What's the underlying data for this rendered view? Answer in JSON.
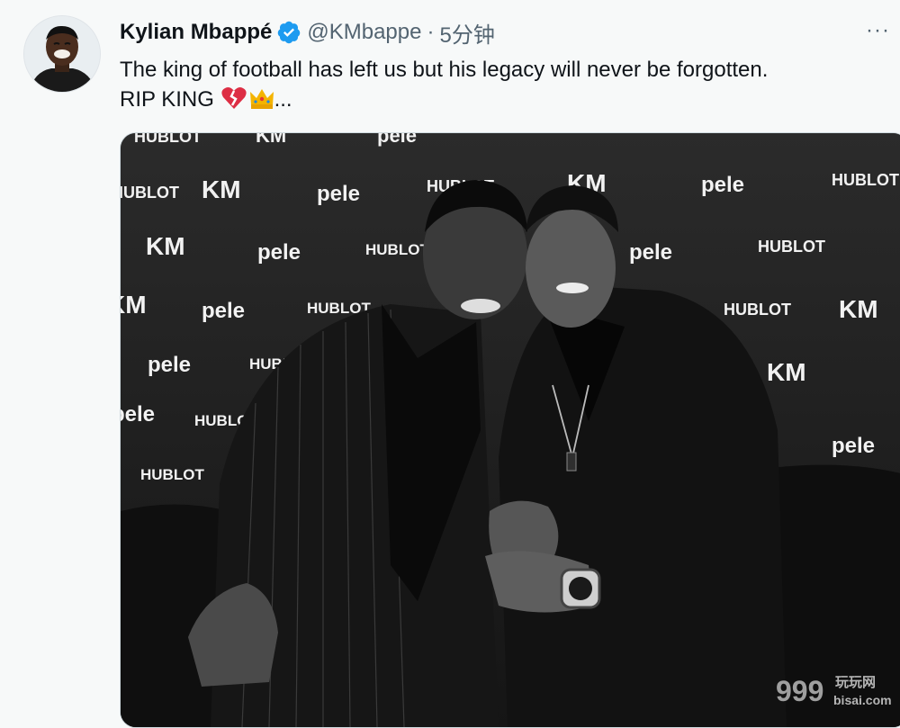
{
  "tweet": {
    "author_name": "Kylian Mbappé",
    "handle": "@KMbappe",
    "separator": "·",
    "time": "5分钟",
    "more": "···",
    "text_line1": "The king of football has left us but his legacy will never be forgotten.",
    "text_line2_prefix": "RIP KING ",
    "text_line2_suffix": "...",
    "emojis": [
      "broken-heart-icon",
      "crown-icon"
    ]
  },
  "media": {
    "backdrop_logos": [
      "HUBLOT",
      "KM",
      "pele"
    ]
  },
  "watermark": {
    "number": "999",
    "brand_cn": "玩玩网",
    "domain": "bisai.com"
  },
  "colors": {
    "verified": "#1d9bf0",
    "handle": "#536471",
    "background": "#f7f9f9",
    "text": "#0f1419"
  }
}
